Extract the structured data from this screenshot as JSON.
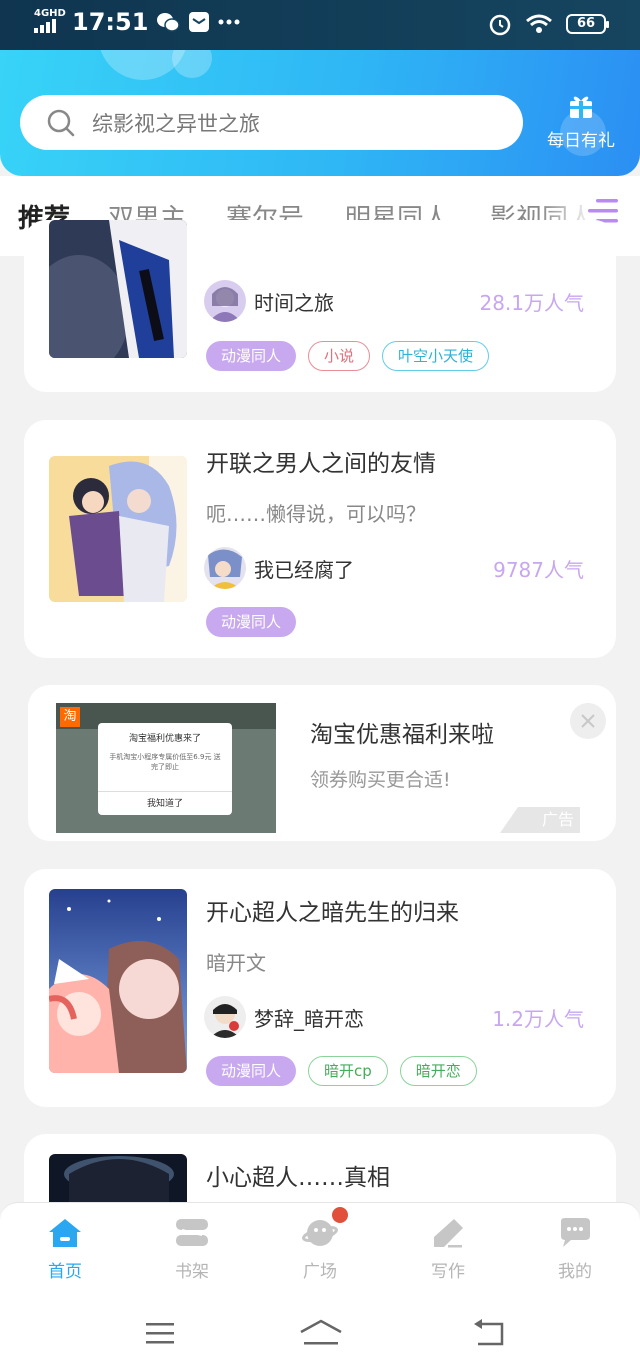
{
  "status": {
    "network": "4GHD",
    "time": "17:51",
    "battery": "66"
  },
  "search": {
    "placeholder": "综影视之异世之旅"
  },
  "gift": {
    "label": "每日有礼"
  },
  "tabs": [
    {
      "label": "推荐",
      "active": true
    },
    {
      "label": "双男主"
    },
    {
      "label": "赛尔号"
    },
    {
      "label": "明星同人"
    },
    {
      "label": "影视同人"
    }
  ],
  "cards": [
    {
      "author": "时间之旅",
      "popularity": "28.1万人气",
      "tags": [
        "动漫同人",
        "小说",
        "叶空小天使"
      ]
    },
    {
      "title": "开联之男人之间的友情",
      "desc": "呃……懒得说，可以吗？",
      "author": "我已经腐了",
      "popularity": "9787人气",
      "tags": [
        "动漫同人"
      ]
    },
    {
      "title": "开心超人之暗先生的归来",
      "desc": "暗开文",
      "author": "梦辞_暗开恋",
      "popularity": "1.2万人气",
      "tags": [
        "动漫同人",
        "暗开cp",
        "暗开恋"
      ]
    },
    {
      "title": "小心超人……真相"
    }
  ],
  "ad": {
    "title": "淘宝优惠福利来啦",
    "subtitle": "领券购买更合适!",
    "badge": "广告",
    "thumb_logo": "淘",
    "thumb_popup_title": "淘宝福利优惠来了",
    "thumb_popup_text": "手机淘宝小程序专属价低至6.9元 送完了即止",
    "thumb_popup_button": "我知道了"
  },
  "bottom_nav": [
    {
      "label": "首页",
      "icon": "home-icon",
      "active": true
    },
    {
      "label": "书架",
      "icon": "bookshelf-icon"
    },
    {
      "label": "广场",
      "icon": "planet-icon",
      "badge_dot": true
    },
    {
      "label": "写作",
      "icon": "pen-icon"
    },
    {
      "label": "我的",
      "icon": "chat-bubble-icon"
    }
  ],
  "colors": {
    "header_start": "#38d4f7",
    "header_end": "#2b8ff3",
    "accent_purple": "#c8a9ef",
    "active_blue": "#2aa7f0"
  }
}
